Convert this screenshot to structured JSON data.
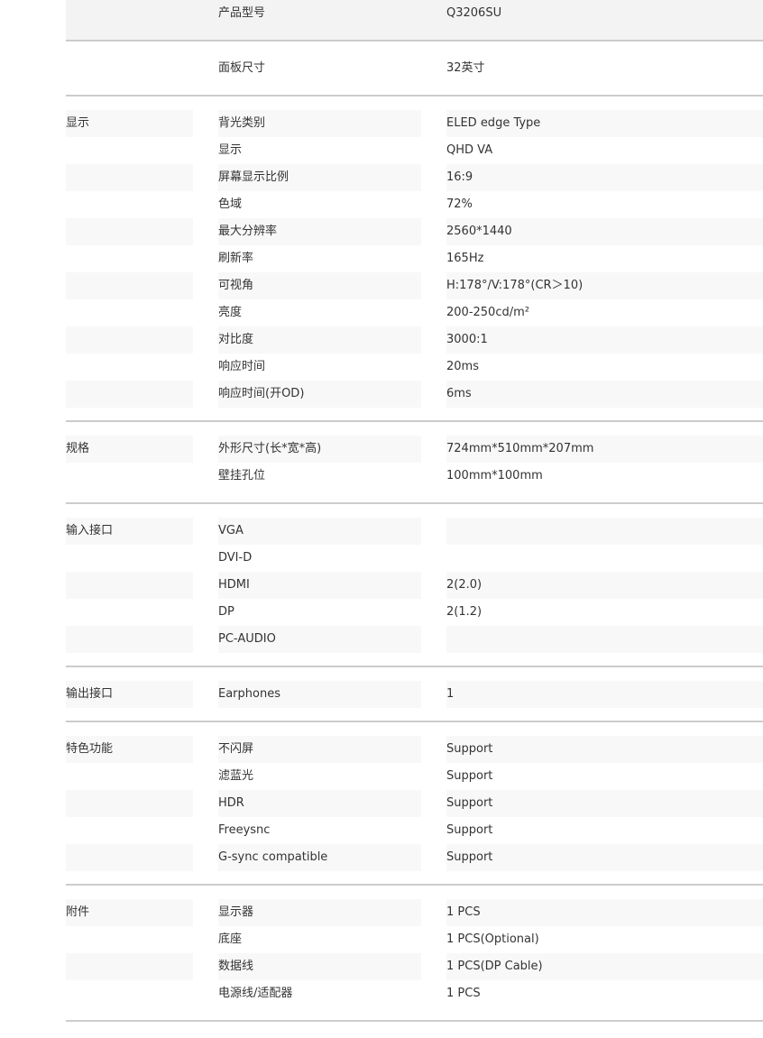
{
  "header_rows": [
    {
      "label": "产品型号",
      "value": "Q3206SU"
    },
    {
      "label": "面板尺寸",
      "value": "32英寸"
    }
  ],
  "sections": [
    {
      "title": "显示",
      "rows": [
        {
          "label": "背光类别",
          "value": "ELED edge Type"
        },
        {
          "label": "显示",
          "value": "QHD VA"
        },
        {
          "label": "屏幕显示比例",
          "value": "16:9"
        },
        {
          "label": "色域",
          "value": "72%"
        },
        {
          "label": "最大分辨率",
          "value": "2560*1440"
        },
        {
          "label": "刷新率",
          "value": "165Hz"
        },
        {
          "label": "可视角",
          "value": "H:178°/V:178°(CR＞10)"
        },
        {
          "label": "亮度",
          "value": "200-250cd/m²"
        },
        {
          "label": "对比度",
          "value": "3000:1"
        },
        {
          "label": "响应时间",
          "value": "20ms"
        },
        {
          "label": "响应时间(开OD)",
          "value": "6ms"
        }
      ]
    },
    {
      "title": "规格",
      "rows": [
        {
          "label": "外形尺寸(长*宽*高)",
          "value": "724mm*510mm*207mm"
        },
        {
          "label": "壁挂孔位",
          "value": "100mm*100mm"
        }
      ]
    },
    {
      "title": "输入接口",
      "rows": [
        {
          "label": "VGA",
          "value": ""
        },
        {
          "label": "DVI-D",
          "value": ""
        },
        {
          "label": "HDMI",
          "value": "2(2.0)"
        },
        {
          "label": "DP",
          "value": "2(1.2)"
        },
        {
          "label": "PC-AUDIO",
          "value": ""
        }
      ]
    },
    {
      "title": "输出接口",
      "rows": [
        {
          "label": "Earphones",
          "value": "1"
        }
      ]
    },
    {
      "title": "特色功能",
      "rows": [
        {
          "label": "不闪屏",
          "value": "Support"
        },
        {
          "label": "滤蓝光",
          "value": "Support"
        },
        {
          "label": "HDR",
          "value": "Support"
        },
        {
          "label": "Freeysnc",
          "value": "Support"
        },
        {
          "label": "G-sync compatible",
          "value": "Support"
        }
      ]
    },
    {
      "title": "附件",
      "rows": [
        {
          "label": "显示器",
          "value": "1 PCS"
        },
        {
          "label": "底座",
          "value": "1 PCS(Optional)"
        },
        {
          "label": "数据线",
          "value": "1 PCS(DP Cable)"
        },
        {
          "label": "电源线/适配器",
          "value": "1 PCS"
        }
      ]
    }
  ]
}
